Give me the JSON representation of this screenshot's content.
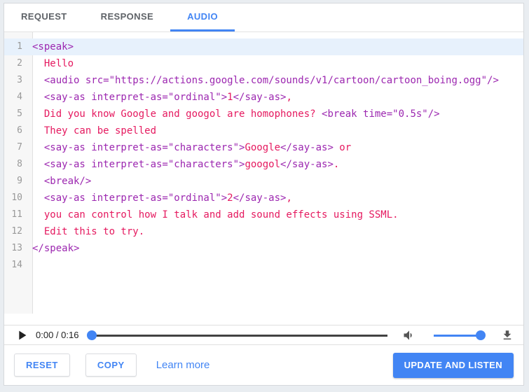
{
  "colors": {
    "accent": "#4285f4",
    "tag_token": "#9c27b0",
    "text_token": "#e5195f",
    "tab_inactive": "#5f6368",
    "active_line_bg": "#e7f1fc"
  },
  "tabs": [
    {
      "label": "REQUEST",
      "active": false
    },
    {
      "label": "RESPONSE",
      "active": false
    },
    {
      "label": "AUDIO",
      "active": true
    }
  ],
  "editor": {
    "lines": [
      {
        "n": 1,
        "highlight": true,
        "segs": [
          {
            "c": "tag",
            "t": "<speak>"
          }
        ]
      },
      {
        "n": 2,
        "highlight": false,
        "segs": [
          {
            "c": "text",
            "t": "  Hello"
          }
        ]
      },
      {
        "n": 3,
        "highlight": false,
        "segs": [
          {
            "c": "text",
            "t": "  "
          },
          {
            "c": "tag",
            "t": "<audio src=\"https://actions.google.com/sounds/v1/cartoon/cartoon_boing.ogg\"/>"
          }
        ]
      },
      {
        "n": 4,
        "highlight": false,
        "segs": [
          {
            "c": "text",
            "t": "  "
          },
          {
            "c": "tag",
            "t": "<say-as interpret-as=\"ordinal\">"
          },
          {
            "c": "text",
            "t": "1"
          },
          {
            "c": "tag",
            "t": "</say-as>"
          },
          {
            "c": "text",
            "t": ","
          }
        ]
      },
      {
        "n": 5,
        "highlight": false,
        "segs": [
          {
            "c": "text",
            "t": "  Did you know Google and googol are homophones? "
          },
          {
            "c": "tag",
            "t": "<break time=\"0.5s\"/>"
          }
        ]
      },
      {
        "n": 6,
        "highlight": false,
        "segs": [
          {
            "c": "text",
            "t": "  They can be spelled"
          }
        ]
      },
      {
        "n": 7,
        "highlight": false,
        "segs": [
          {
            "c": "text",
            "t": "  "
          },
          {
            "c": "tag",
            "t": "<say-as interpret-as=\"characters\">"
          },
          {
            "c": "text",
            "t": "Google"
          },
          {
            "c": "tag",
            "t": "</say-as>"
          },
          {
            "c": "text",
            "t": " or"
          }
        ]
      },
      {
        "n": 8,
        "highlight": false,
        "segs": [
          {
            "c": "text",
            "t": "  "
          },
          {
            "c": "tag",
            "t": "<say-as interpret-as=\"characters\">"
          },
          {
            "c": "text",
            "t": "googol"
          },
          {
            "c": "tag",
            "t": "</say-as>"
          },
          {
            "c": "text",
            "t": "."
          }
        ]
      },
      {
        "n": 9,
        "highlight": false,
        "segs": [
          {
            "c": "text",
            "t": "  "
          },
          {
            "c": "tag",
            "t": "<break/>"
          }
        ]
      },
      {
        "n": 10,
        "highlight": false,
        "segs": [
          {
            "c": "text",
            "t": "  "
          },
          {
            "c": "tag",
            "t": "<say-as interpret-as=\"ordinal\">"
          },
          {
            "c": "text",
            "t": "2"
          },
          {
            "c": "tag",
            "t": "</say-as>"
          },
          {
            "c": "text",
            "t": ","
          }
        ]
      },
      {
        "n": 11,
        "highlight": false,
        "segs": [
          {
            "c": "text",
            "t": "  you can control how I talk and add sound effects using SSML."
          }
        ]
      },
      {
        "n": 12,
        "highlight": false,
        "segs": [
          {
            "c": "text",
            "t": "  Edit this to try."
          }
        ]
      },
      {
        "n": 13,
        "highlight": false,
        "segs": [
          {
            "c": "tag",
            "t": "</speak>"
          }
        ]
      },
      {
        "n": 14,
        "highlight": false,
        "segs": []
      }
    ]
  },
  "player": {
    "time": "0:00 / 0:16",
    "icons": {
      "play": "play-icon",
      "volume": "volume-up-icon",
      "download": "download-icon"
    }
  },
  "footer": {
    "reset_label": "RESET",
    "copy_label": "COPY",
    "learn_more_label": "Learn more",
    "update_label": "UPDATE AND LISTEN"
  }
}
